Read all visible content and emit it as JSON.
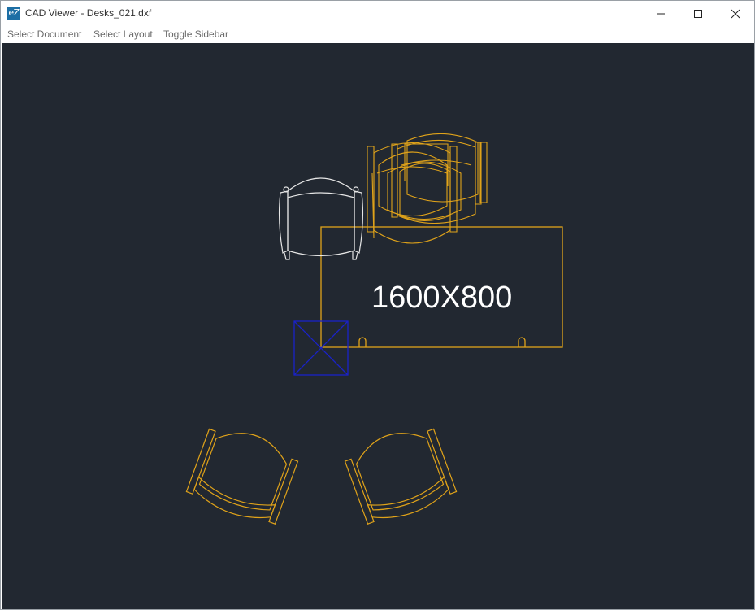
{
  "window": {
    "title": "CAD Viewer - Desks_021.dxf",
    "app_icon_text": "eZ",
    "minimize_glyph": "—",
    "maximize_glyph": "☐",
    "close_glyph": "✕"
  },
  "menu": {
    "items": [
      "Select Document",
      "Select Layout",
      "Toggle Sidebar"
    ]
  },
  "drawing": {
    "desk_label": "1600X800",
    "colors": {
      "background": "#222831",
      "furniture": "#e0a31a",
      "white_chair": "#e6e6e6",
      "marker": "#1a22c8"
    }
  }
}
